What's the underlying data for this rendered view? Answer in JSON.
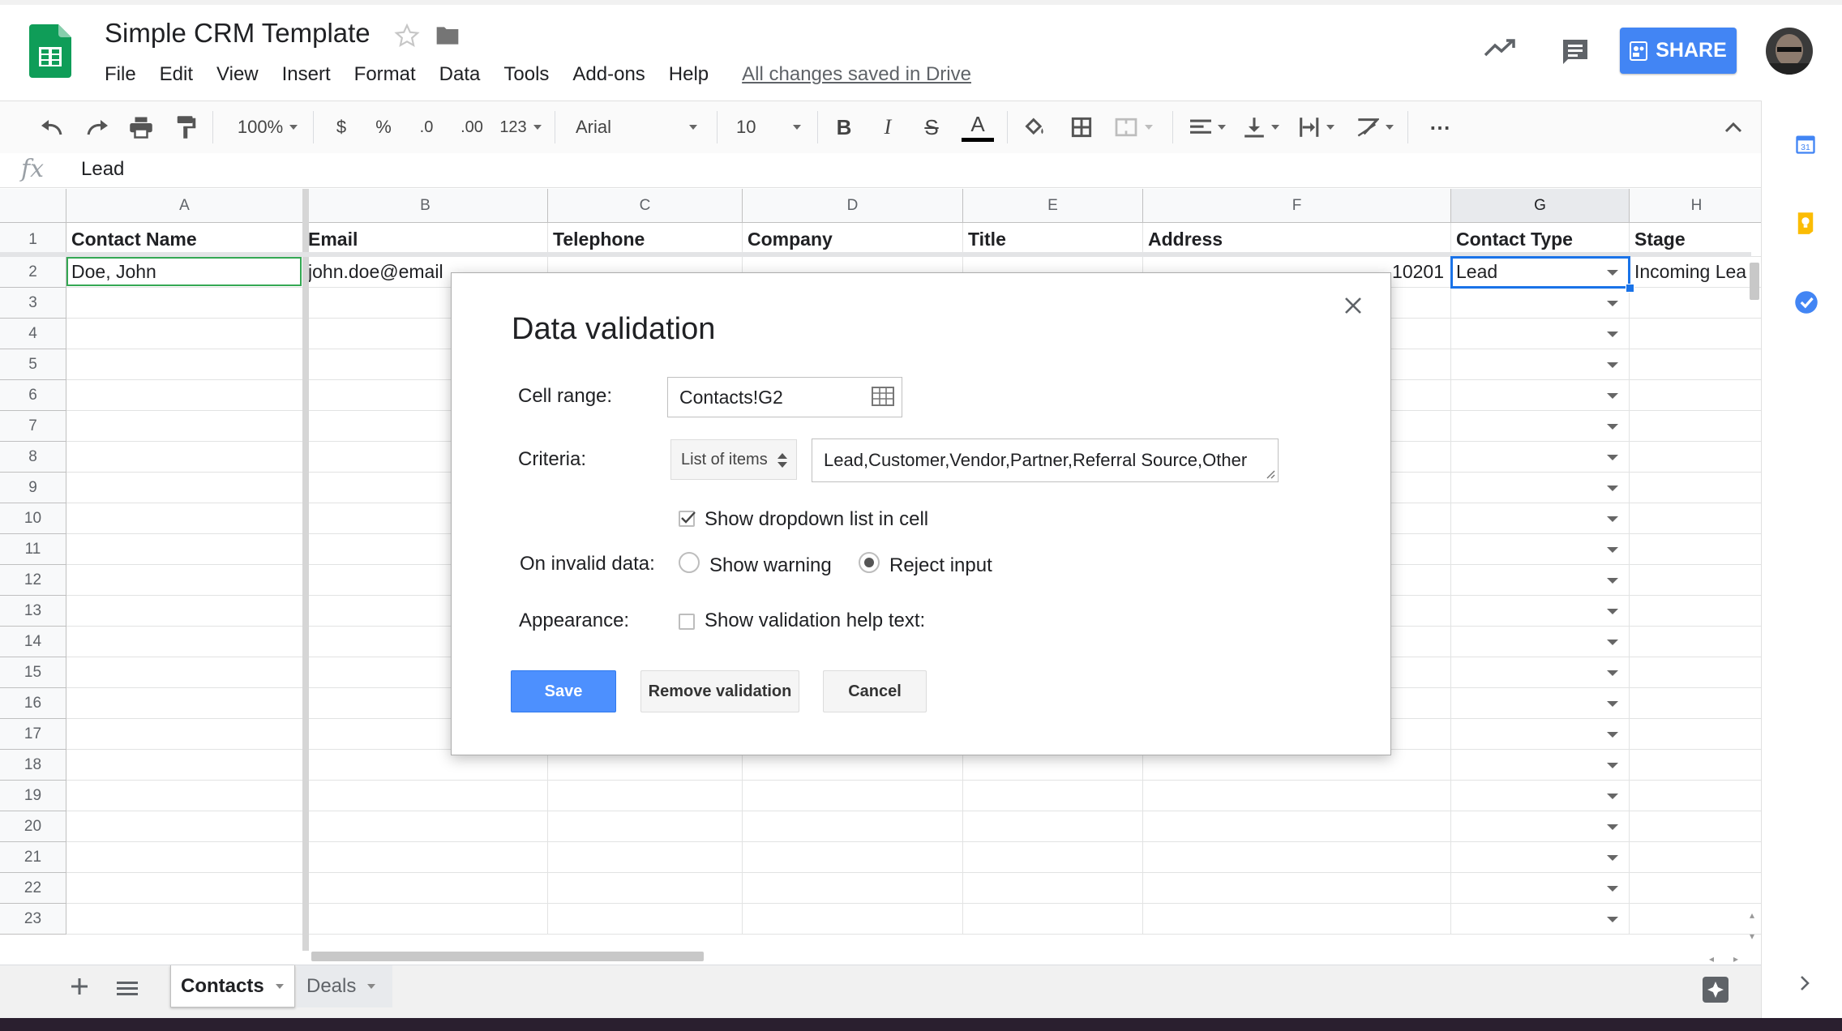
{
  "app": {
    "title": "Simple CRM Template",
    "icon": "sheets-logo-icon",
    "menu": [
      "File",
      "Edit",
      "View",
      "Insert",
      "Format",
      "Data",
      "Tools",
      "Add-ons",
      "Help"
    ],
    "save_status": "All changes saved in Drive",
    "share_label": "SHARE"
  },
  "toolbar": {
    "zoom": "100%",
    "currency": "$",
    "percent": "%",
    "decrease_decimals": ".0",
    "increase_decimals": ".00",
    "more_formats": "123",
    "font": "Arial",
    "font_size": "10",
    "bold": "B",
    "italic": "I",
    "strikethrough": "S",
    "text_color": "A",
    "more": "⋯"
  },
  "formula_bar": {
    "fx": "fx",
    "value": "Lead"
  },
  "grid": {
    "columns": [
      "A",
      "B",
      "C",
      "D",
      "E",
      "F",
      "G",
      "H"
    ],
    "rows": [
      "1",
      "2",
      "3",
      "4",
      "5",
      "6",
      "7",
      "8",
      "9",
      "10",
      "11",
      "12",
      "13",
      "14",
      "15",
      "16",
      "17",
      "18",
      "19",
      "20",
      "21",
      "22",
      "23"
    ],
    "header_row": [
      "Contact Name",
      "Email",
      "Telephone",
      "Company",
      "Title",
      "Address",
      "Contact Type",
      "Stage"
    ],
    "row2": {
      "a": "Doe, John",
      "b": "john.doe@email",
      "f_tail": "10201",
      "g": "Lead",
      "h": "Incoming Lea"
    }
  },
  "sheets": {
    "tabs": [
      "Contacts",
      "Deals"
    ],
    "active": "Contacts"
  },
  "dialog": {
    "title": "Data validation",
    "cell_range_label": "Cell range:",
    "cell_range_value": "Contacts!G2",
    "criteria_label": "Criteria:",
    "criteria_type": "List of items",
    "criteria_value": "Lead,Customer,Vendor,Partner,Referral Source,Other",
    "show_dropdown_label": "Show dropdown list in cell",
    "show_dropdown_checked": true,
    "invalid_label": "On invalid data:",
    "show_warning_label": "Show warning",
    "reject_input_label": "Reject input",
    "invalid_choice": "reject",
    "appearance_label": "Appearance:",
    "help_text_label": "Show validation help text:",
    "help_text_checked": false,
    "save_label": "Save",
    "remove_label": "Remove validation",
    "cancel_label": "Cancel"
  },
  "colors": {
    "accent": "#4285f4",
    "save_button": "#4d90fe",
    "sheets_green": "#0f9d58",
    "selection_blue": "#1a73e8",
    "active_cell_green": "#34a853"
  }
}
